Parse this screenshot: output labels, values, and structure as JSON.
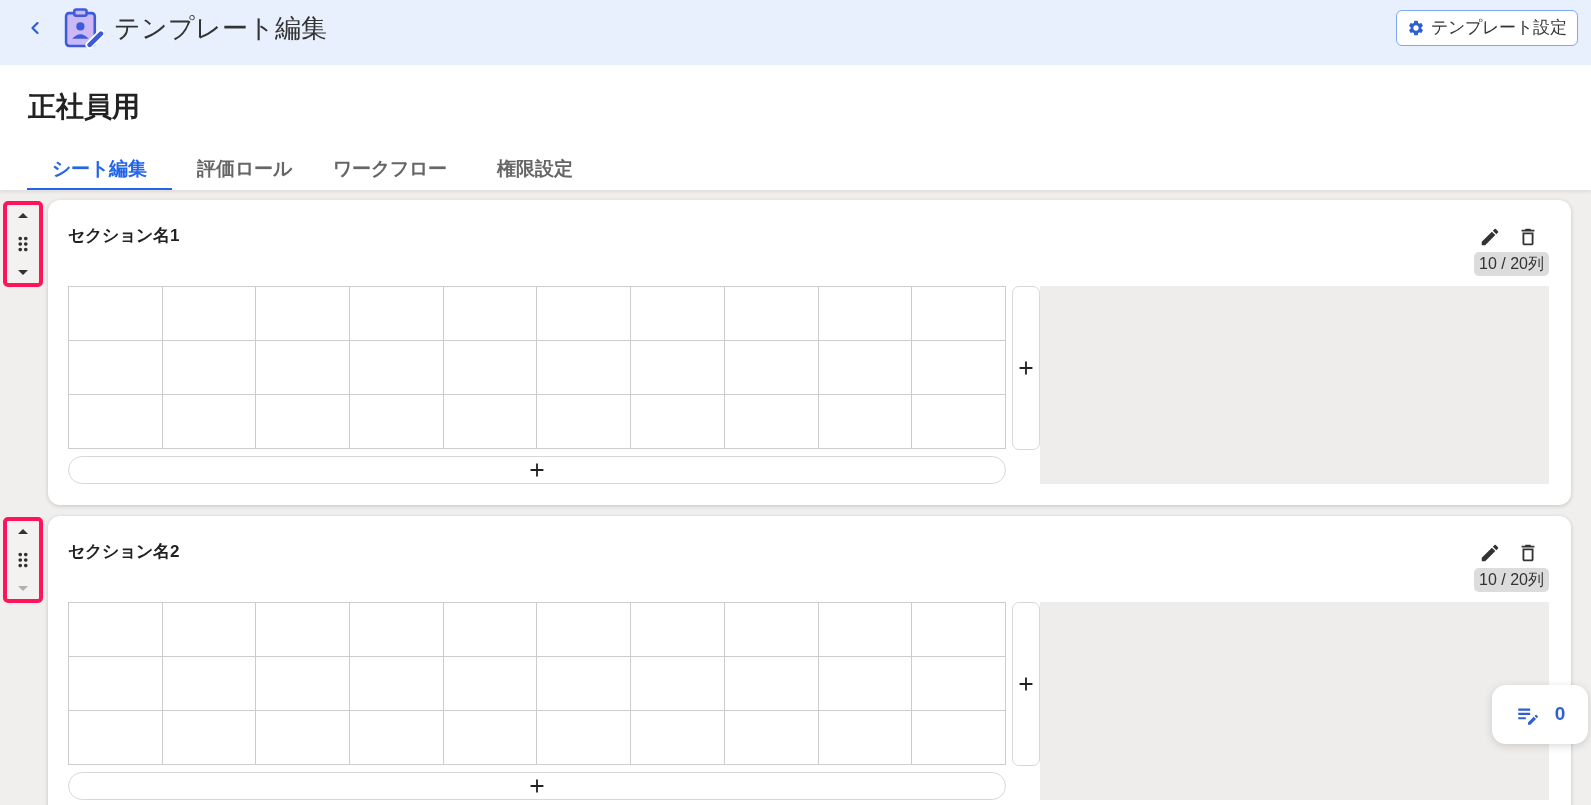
{
  "header": {
    "title": "テンプレート編集",
    "settings_button": {
      "label": "テンプレート設定"
    }
  },
  "page_title": "正社員用",
  "tabs": [
    {
      "label": "シート編集",
      "selected": true
    },
    {
      "label": "評価ロール",
      "selected": false
    },
    {
      "label": "ワークフロー",
      "selected": false
    },
    {
      "label": "権限設定",
      "selected": false
    }
  ],
  "sections": [
    {
      "name": "セクション名1",
      "column_count": "10 / 20列",
      "handle": {
        "highlighted": true,
        "up_disabled": false,
        "down_disabled": false
      }
    },
    {
      "name": "セクション名2",
      "column_count": "10 / 20列",
      "handle": {
        "highlighted": true,
        "up_disabled": false,
        "down_disabled": true
      }
    }
  ],
  "notes_button": {
    "count": "0"
  }
}
